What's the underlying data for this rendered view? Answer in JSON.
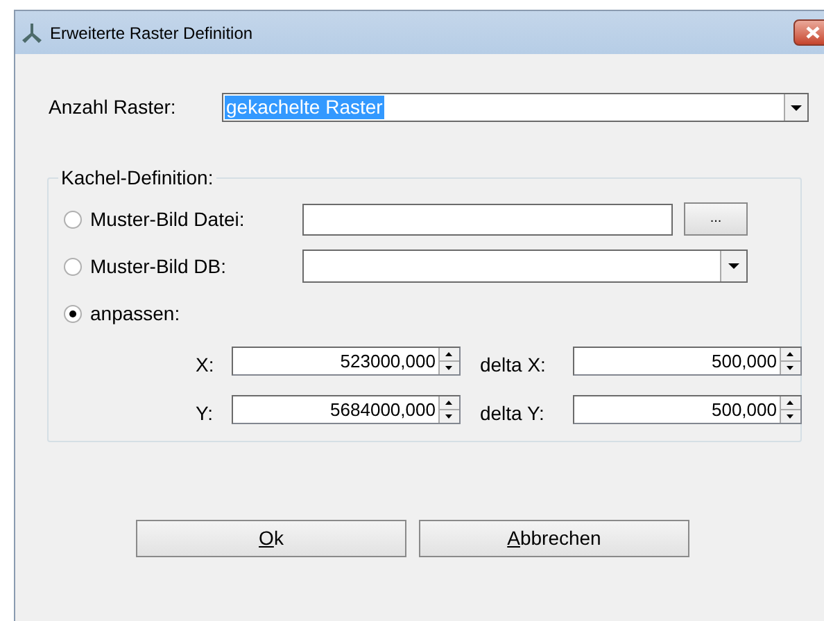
{
  "window": {
    "title": "Erweiterte Raster Definition"
  },
  "anzahl_raster": {
    "label": "Anzahl Raster:",
    "value": "gekachelte Raster",
    "selected_text": true
  },
  "group": {
    "title": "Kachel-Definition:",
    "options": [
      {
        "kind": "file",
        "label": "Muster-Bild Datei:",
        "selected": false,
        "button": "..."
      },
      {
        "kind": "combo",
        "label": "Muster-Bild DB:",
        "selected": false
      },
      {
        "kind": "plain",
        "label": "anpassen:",
        "selected": true
      }
    ],
    "spinners": [
      {
        "label": "X:",
        "value": "523000,000",
        "delta_label": "delta X:",
        "delta_value": "500,000"
      },
      {
        "label": "Y:",
        "value": "5684000,000",
        "delta_label": "delta Y:",
        "delta_value": "500,000"
      }
    ]
  },
  "buttons": [
    {
      "accesskey": "O",
      "rest": "k"
    },
    {
      "accesskey": "A",
      "rest": "bbrechen"
    }
  ]
}
